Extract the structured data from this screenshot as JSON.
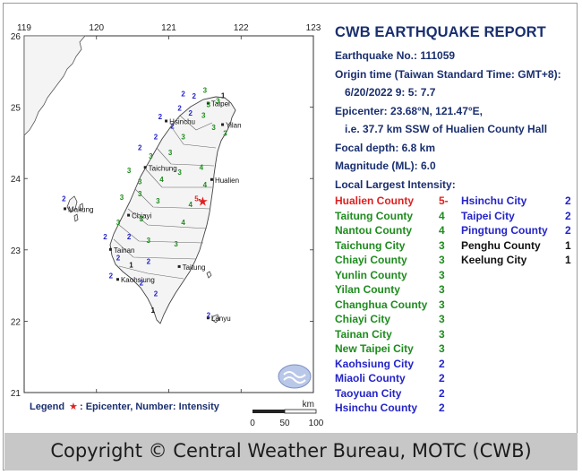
{
  "map": {
    "lon_labels": [
      "119",
      "120",
      "121",
      "122",
      "123"
    ],
    "lat_labels": [
      "26",
      "25",
      "24",
      "23",
      "22",
      "21"
    ],
    "place_labels": [
      {
        "name": "Taipei",
        "lon": 121.55,
        "lat": 25.05
      },
      {
        "name": "Hsinchu",
        "lon": 120.97,
        "lat": 24.8
      },
      {
        "name": "Yilan",
        "lon": 121.75,
        "lat": 24.75
      },
      {
        "name": "Taichung",
        "lon": 120.68,
        "lat": 24.15
      },
      {
        "name": "Hualien",
        "lon": 121.6,
        "lat": 23.98
      },
      {
        "name": "Makung",
        "lon": 119.57,
        "lat": 23.57
      },
      {
        "name": "Chiayi",
        "lon": 120.45,
        "lat": 23.48
      },
      {
        "name": "Tainan",
        "lon": 120.2,
        "lat": 23.0
      },
      {
        "name": "Taitung",
        "lon": 121.15,
        "lat": 22.76
      },
      {
        "name": "Kaohsiung",
        "lon": 120.3,
        "lat": 22.58
      },
      {
        "name": "Lanyu",
        "lon": 121.55,
        "lat": 22.04
      }
    ],
    "station_values": [
      {
        "v": "2",
        "lon": 121.2,
        "lat": 25.15,
        "c": "#2424c8"
      },
      {
        "v": "2",
        "lon": 121.35,
        "lat": 25.12,
        "c": "#2424c8"
      },
      {
        "v": "3",
        "lon": 121.5,
        "lat": 25.2,
        "c": "#1e8c1e"
      },
      {
        "v": "3",
        "lon": 121.55,
        "lat": 25.0,
        "c": "#1e8c1e"
      },
      {
        "v": "3",
        "lon": 121.68,
        "lat": 25.05,
        "c": "#1e8c1e"
      },
      {
        "v": "1",
        "lon": 121.75,
        "lat": 25.13,
        "c": "#111111"
      },
      {
        "v": "2",
        "lon": 121.15,
        "lat": 24.95,
        "c": "#2424c8"
      },
      {
        "v": "2",
        "lon": 121.3,
        "lat": 24.88,
        "c": "#2424c8"
      },
      {
        "v": "2",
        "lon": 121.05,
        "lat": 24.7,
        "c": "#2424c8"
      },
      {
        "v": "2",
        "lon": 120.88,
        "lat": 24.83,
        "c": "#2424c8"
      },
      {
        "v": "3",
        "lon": 121.48,
        "lat": 24.85,
        "c": "#1e8c1e"
      },
      {
        "v": "3",
        "lon": 121.62,
        "lat": 24.68,
        "c": "#1e8c1e"
      },
      {
        "v": "3",
        "lon": 121.78,
        "lat": 24.6,
        "c": "#1e8c1e"
      },
      {
        "v": "3",
        "lon": 121.2,
        "lat": 24.55,
        "c": "#1e8c1e"
      },
      {
        "v": "2",
        "lon": 120.82,
        "lat": 24.55,
        "c": "#2424c8"
      },
      {
        "v": "2",
        "lon": 120.6,
        "lat": 24.4,
        "c": "#2424c8"
      },
      {
        "v": "3",
        "lon": 120.75,
        "lat": 24.28,
        "c": "#1e8c1e"
      },
      {
        "v": "3",
        "lon": 121.02,
        "lat": 24.33,
        "c": "#1e8c1e"
      },
      {
        "v": "3",
        "lon": 120.45,
        "lat": 24.08,
        "c": "#1e8c1e"
      },
      {
        "v": "3",
        "lon": 120.6,
        "lat": 23.92,
        "c": "#1e8c1e"
      },
      {
        "v": "4",
        "lon": 120.9,
        "lat": 23.95,
        "c": "#1e8c1e"
      },
      {
        "v": "3",
        "lon": 121.15,
        "lat": 24.05,
        "c": "#1e8c1e"
      },
      {
        "v": "4",
        "lon": 121.45,
        "lat": 24.12,
        "c": "#1e8c1e"
      },
      {
        "v": "4",
        "lon": 121.5,
        "lat": 23.88,
        "c": "#1e8c1e"
      },
      {
        "v": "3",
        "lon": 120.35,
        "lat": 23.7,
        "c": "#1e8c1e"
      },
      {
        "v": "3",
        "lon": 120.6,
        "lat": 23.75,
        "c": "#1e8c1e"
      },
      {
        "v": "3",
        "lon": 120.85,
        "lat": 23.65,
        "c": "#1e8c1e"
      },
      {
        "v": "4",
        "lon": 121.3,
        "lat": 23.6,
        "c": "#1e8c1e"
      },
      {
        "v": "3",
        "lon": 120.3,
        "lat": 23.35,
        "c": "#1e8c1e"
      },
      {
        "v": "3",
        "lon": 120.62,
        "lat": 23.4,
        "c": "#1e8c1e"
      },
      {
        "v": "4",
        "lon": 121.2,
        "lat": 23.35,
        "c": "#1e8c1e"
      },
      {
        "v": "2",
        "lon": 120.12,
        "lat": 23.15,
        "c": "#2424c8"
      },
      {
        "v": "2",
        "lon": 120.45,
        "lat": 23.15,
        "c": "#2424c8"
      },
      {
        "v": "3",
        "lon": 120.72,
        "lat": 23.1,
        "c": "#1e8c1e"
      },
      {
        "v": "3",
        "lon": 121.1,
        "lat": 23.05,
        "c": "#1e8c1e"
      },
      {
        "v": "2",
        "lon": 120.3,
        "lat": 22.85,
        "c": "#2424c8"
      },
      {
        "v": "1",
        "lon": 120.48,
        "lat": 22.75,
        "c": "#111111"
      },
      {
        "v": "2",
        "lon": 120.72,
        "lat": 22.8,
        "c": "#2424c8"
      },
      {
        "v": "2",
        "lon": 120.2,
        "lat": 22.6,
        "c": "#2424c8"
      },
      {
        "v": "2",
        "lon": 120.62,
        "lat": 22.5,
        "c": "#2424c8"
      },
      {
        "v": "2",
        "lon": 120.82,
        "lat": 22.35,
        "c": "#2424c8"
      },
      {
        "v": "1",
        "lon": 120.78,
        "lat": 22.12,
        "c": "#111111"
      },
      {
        "v": "2",
        "lon": 119.55,
        "lat": 23.68,
        "c": "#2424c8"
      },
      {
        "v": "5-",
        "lon": 121.4,
        "lat": 23.68,
        "c": "#e02020"
      },
      {
        "v": "2",
        "lon": 121.55,
        "lat": 22.05,
        "c": "#2424c8"
      }
    ],
    "epicenter": {
      "lon": 121.47,
      "lat": 23.68
    },
    "legend_label": "Legend",
    "legend_text": ": Epicenter, Number: Intensity",
    "scale_ticks": [
      "0",
      "50",
      "100"
    ],
    "scale_unit": "km"
  },
  "report": {
    "title": "CWB EARTHQUAKE REPORT",
    "eq_no": "Earthquake No.: 111059",
    "origin_label": "Origin time (Taiwan Standard Time: GMT+8):",
    "origin_value": "6/20/2022  9: 5: 7.7",
    "epicenter": "Epicenter: 23.68°N, 121.47°E,",
    "epicenter_desc": "i.e. 37.7 km SSW of Hualien County Hall",
    "depth": "Focal depth: 6.8 km",
    "magnitude": "Magnitude (ML): 6.0",
    "intensity_label": "Local Largest Intensity:",
    "intensities_left": [
      {
        "name": "Hualien County",
        "value": "5-",
        "color": "#e02020"
      },
      {
        "name": "Taitung County",
        "value": "4",
        "color": "#1e8c1e"
      },
      {
        "name": "Nantou County",
        "value": "4",
        "color": "#1e8c1e"
      },
      {
        "name": "Taichung City",
        "value": "3",
        "color": "#1e8c1e"
      },
      {
        "name": "Chiayi County",
        "value": "3",
        "color": "#1e8c1e"
      },
      {
        "name": "Yunlin County",
        "value": "3",
        "color": "#1e8c1e"
      },
      {
        "name": "Yilan County",
        "value": "3",
        "color": "#1e8c1e"
      },
      {
        "name": "Changhua County",
        "value": "3",
        "color": "#1e8c1e"
      },
      {
        "name": "Chiayi City",
        "value": "3",
        "color": "#1e8c1e"
      },
      {
        "name": "Tainan City",
        "value": "3",
        "color": "#1e8c1e"
      },
      {
        "name": "New Taipei City",
        "value": "3",
        "color": "#1e8c1e"
      },
      {
        "name": "Kaohsiung City",
        "value": "2",
        "color": "#2424c8"
      },
      {
        "name": "Miaoli County",
        "value": "2",
        "color": "#2424c8"
      },
      {
        "name": "Taoyuan City",
        "value": "2",
        "color": "#2424c8"
      },
      {
        "name": "Hsinchu County",
        "value": "2",
        "color": "#2424c8"
      }
    ],
    "intensities_right": [
      {
        "name": "Hsinchu City",
        "value": "2",
        "color": "#2424c8"
      },
      {
        "name": "Taipei City",
        "value": "2",
        "color": "#2424c8"
      },
      {
        "name": "Pingtung County",
        "value": "2",
        "color": "#2424c8"
      },
      {
        "name": "Penghu County",
        "value": "1",
        "color": "#111111"
      },
      {
        "name": "Keelung City",
        "value": "1",
        "color": "#111111"
      }
    ]
  },
  "footer": {
    "copyright": "Copyright © Central Weather Bureau, MOTC (CWB)"
  },
  "colors": {
    "title": "#1a2f6f",
    "land": "#f4f4f4",
    "epicenter": "#e02020"
  }
}
